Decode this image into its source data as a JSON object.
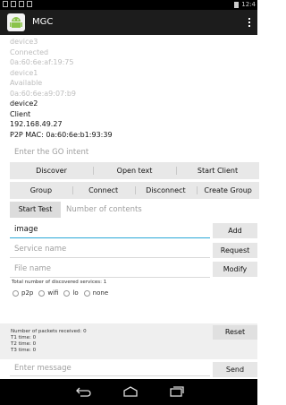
{
  "status_bar": {
    "time": "12:4"
  },
  "app": {
    "title": "MGC"
  },
  "devices": [
    {
      "lines": [
        "device3",
        "Connected",
        "0a:60:6e:af:19:75"
      ],
      "dim": true
    },
    {
      "lines": [
        "device1",
        "Available",
        "0a:60:6e:a9:07:b9"
      ],
      "dim": true
    },
    {
      "lines": [
        "device2",
        "Client",
        "192.168.49.27",
        "P2P MAC: 0a:60:6e:b1:93:39"
      ],
      "dim": false
    }
  ],
  "go_intent": {
    "placeholder": "Enter the GO intent"
  },
  "row1": {
    "discover": "Discover",
    "open_text": "Open text",
    "start_client": "Start Client"
  },
  "row2": {
    "group": "Group",
    "connect": "Connect",
    "disconnect": "Disconnect",
    "create_group": "Create Group"
  },
  "test": {
    "start_test": "Start Test",
    "contents_placeholder": "Number of contents"
  },
  "image_field": {
    "value": "image",
    "button": "Add"
  },
  "service_field": {
    "placeholder": "Service name",
    "button": "Request"
  },
  "file_field": {
    "placeholder": "File name",
    "button": "Modify"
  },
  "discovered": {
    "text": "Total number of discovered services: 1"
  },
  "radios": [
    "p2p",
    "wifi",
    "lo",
    "none"
  ],
  "packets": {
    "lines": [
      "Number of packets received: 0",
      "T1 time: 0",
      "T2 time: 0",
      "T3 time: 0"
    ],
    "reset": "Reset"
  },
  "message": {
    "placeholder": "Enter message",
    "send": "Send"
  },
  "colors": {
    "accent": "#2aa8d8",
    "action_bar": "#1c1c1c",
    "button": "#e6e6e6"
  }
}
